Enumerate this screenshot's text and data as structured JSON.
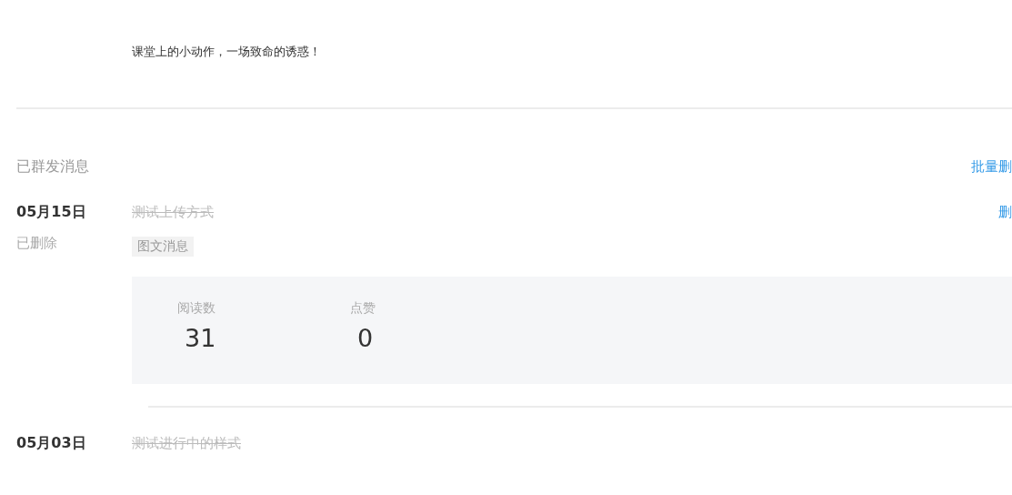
{
  "draft": {
    "title": "课堂上的小动作，一场致命的诱惑！"
  },
  "sent": {
    "heading": "已群发消息",
    "batch_delete": "批量删",
    "messages": [
      {
        "date": "05月15日",
        "status": "已删除",
        "title": "测试上传方式",
        "deleted": true,
        "type_tag": "图文消息",
        "action": "删",
        "stats": [
          {
            "label": "阅读数",
            "value": "31"
          },
          {
            "label": "点赞",
            "value": "0"
          }
        ]
      },
      {
        "date": "05月03日",
        "title": "测试进行中的样式",
        "deleted": true
      }
    ]
  }
}
